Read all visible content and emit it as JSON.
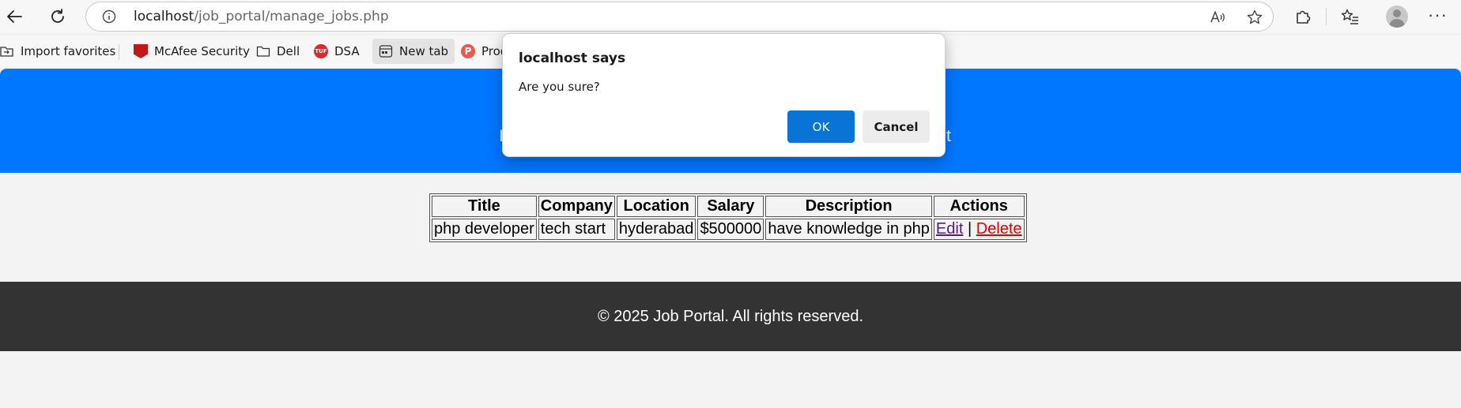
{
  "browser": {
    "url_host": "localhost",
    "url_path": "/job_portal/manage_jobs.php"
  },
  "favorites": [
    {
      "label": "Import favorites",
      "icon": "import-icon"
    },
    {
      "label": "McAfee Security",
      "icon": "mcafee-icon"
    },
    {
      "label": "Dell",
      "icon": "folder-icon"
    },
    {
      "label": "DSA",
      "icon": "tuf-icon"
    },
    {
      "label": "New tab",
      "icon": "newtab-icon"
    },
    {
      "label": "Prod",
      "icon": "p-icon"
    }
  ],
  "header": {
    "fragment_left": "I",
    "fragment_right": "t",
    "background": "#0077ff"
  },
  "table": {
    "headers": [
      "Title",
      "Company",
      "Location",
      "Salary",
      "Description",
      "Actions"
    ],
    "rows": [
      {
        "title": "php developer",
        "company": "tech start",
        "location": "hyderabad",
        "salary": "$500000",
        "description": "have knowledge in php",
        "edit": "Edit",
        "separator": "|",
        "delete": "Delete"
      }
    ]
  },
  "footer": {
    "text": "© 2025 Job Portal. All rights reserved.",
    "background": "#333333"
  },
  "dialog": {
    "title": "localhost says",
    "message": "Are you sure?",
    "ok_label": "OK",
    "cancel_label": "Cancel",
    "accent": "#0a73d6"
  }
}
